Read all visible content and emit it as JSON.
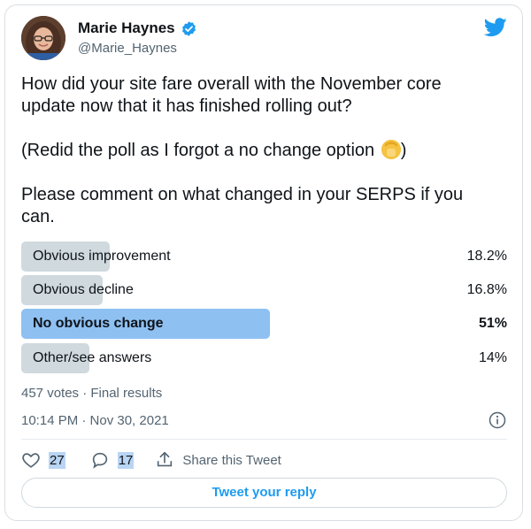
{
  "author": {
    "name": "Marie Haynes",
    "handle": "@Marie_Haynes"
  },
  "tweet": {
    "line1": "How did your site fare overall with the November core update now that it has finished rolling out?",
    "line2": "(Redid the poll as I forgot a no change option",
    "line2_end": ")",
    "line3": "Please comment on what changed in your SERPS if you can."
  },
  "poll": {
    "options": [
      {
        "label": "Obvious improvement",
        "percent": "18.2%",
        "fraction": 0.182
      },
      {
        "label": "Obvious decline",
        "percent": "16.8%",
        "fraction": 0.168
      },
      {
        "label": "No obvious change",
        "percent": "51%",
        "fraction": 0.51,
        "winner": true
      },
      {
        "label": "Other/see answers",
        "percent": "14%",
        "fraction": 0.14
      }
    ],
    "summary": "457 votes · Final results"
  },
  "timestamp": "10:14 PM · Nov 30, 2021",
  "actions": {
    "likes": "27",
    "replies": "17",
    "share_label": "Share this Tweet"
  },
  "reply_button": "Tweet your reply",
  "colors": {
    "accent": "#1d9bf0",
    "poll_bar": "#cfd9de",
    "poll_winner": "#8ec0f2",
    "verified": "#1d9bf0"
  },
  "icons": [
    "verified-badge-icon",
    "twitter-bird-icon",
    "info-icon",
    "heart-icon",
    "reply-icon",
    "share-icon",
    "facepalm-emoji"
  ]
}
